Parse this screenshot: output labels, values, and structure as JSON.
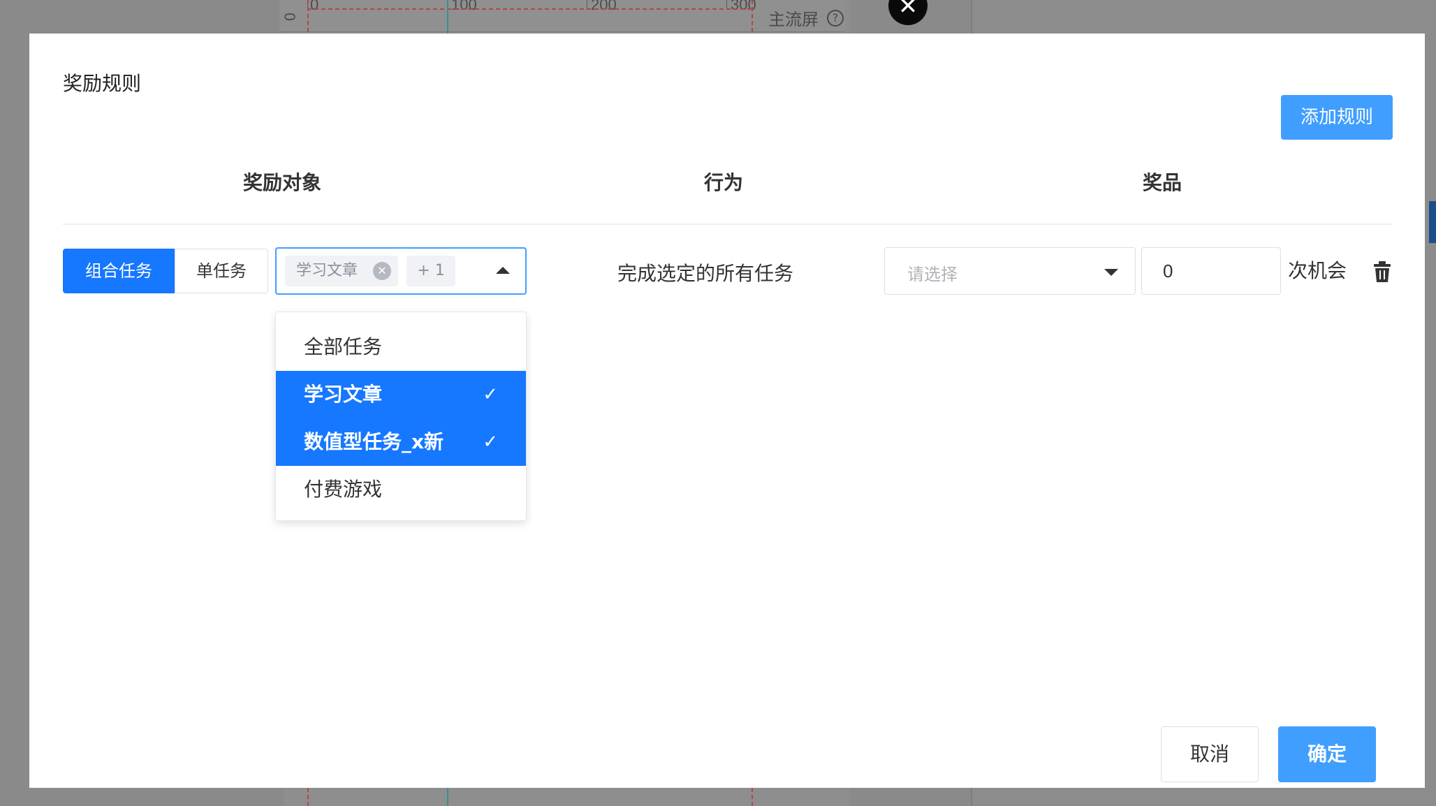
{
  "background": {
    "ruler_labels": [
      "0",
      "100",
      "200",
      "300"
    ],
    "main_screen_label": "主流屏",
    "help_icon_glyph": "?",
    "close_glyph": "✕"
  },
  "modal": {
    "title": "奖励规则",
    "add_rule_label": "添加规则",
    "columns": {
      "target": "奖励对象",
      "behavior": "行为",
      "prize": "奖品"
    },
    "rule_row": {
      "segment": {
        "combined_label": "组合任务",
        "single_label": "单任务",
        "selected": "组合任务"
      },
      "task_select": {
        "tag_label": "学习文章",
        "more_count_label": "+ 1",
        "options": [
          {
            "label": "全部任务",
            "selected": false
          },
          {
            "label": "学习文章",
            "selected": true
          },
          {
            "label": "数值型任务_x新",
            "selected": true
          },
          {
            "label": "付费游戏",
            "selected": false
          }
        ]
      },
      "behavior_text": "完成选定的所有任务",
      "prize_select_placeholder": "请选择",
      "chance_value": "0",
      "chance_suffix": "次机会"
    },
    "cancel_label": "取消",
    "confirm_label": "确定"
  },
  "colors": {
    "primary": "#409eff",
    "segment_active": "#1677ff",
    "dropdown_selected": "#1677ff"
  }
}
